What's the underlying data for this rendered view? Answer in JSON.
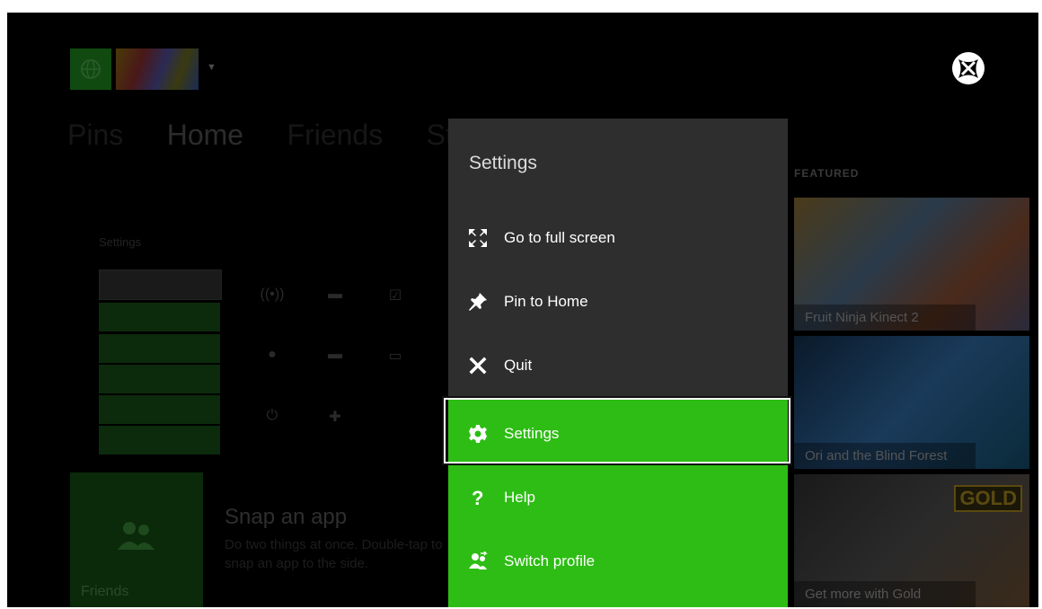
{
  "header": {
    "nav_tabs": [
      {
        "label": "Pins"
      },
      {
        "label": "Home"
      },
      {
        "label": "Friends"
      },
      {
        "label": "Store"
      }
    ]
  },
  "background": {
    "settings_tile": {
      "title": "Settings"
    },
    "friends_tile": {
      "label": "Friends"
    },
    "snap": {
      "title": "Snap an app",
      "description": "Do two things at once. Double-tap to snap an app to the side."
    },
    "featured": {
      "label": "FEATURED",
      "tiles": [
        {
          "caption": "Fruit Ninja Kinect 2"
        },
        {
          "caption": "Ori and the Blind Forest"
        },
        {
          "caption": "Get more with Gold",
          "badge": "GOLD"
        }
      ]
    }
  },
  "flyout": {
    "title": "Settings",
    "items": [
      {
        "label": "Go to full screen",
        "icon": "fullscreen-icon"
      },
      {
        "label": "Pin to Home",
        "icon": "pin-icon"
      },
      {
        "label": "Quit",
        "icon": "close-icon"
      },
      {
        "label": "Settings",
        "icon": "gear-icon",
        "focused": true
      },
      {
        "label": "Help",
        "icon": "question-icon"
      },
      {
        "label": "Switch profile",
        "icon": "switch-profile-icon"
      }
    ]
  },
  "colors": {
    "accent_green": "#2dbd14",
    "flyout_bg": "#2e2e2e",
    "screen_bg": "#000000"
  }
}
